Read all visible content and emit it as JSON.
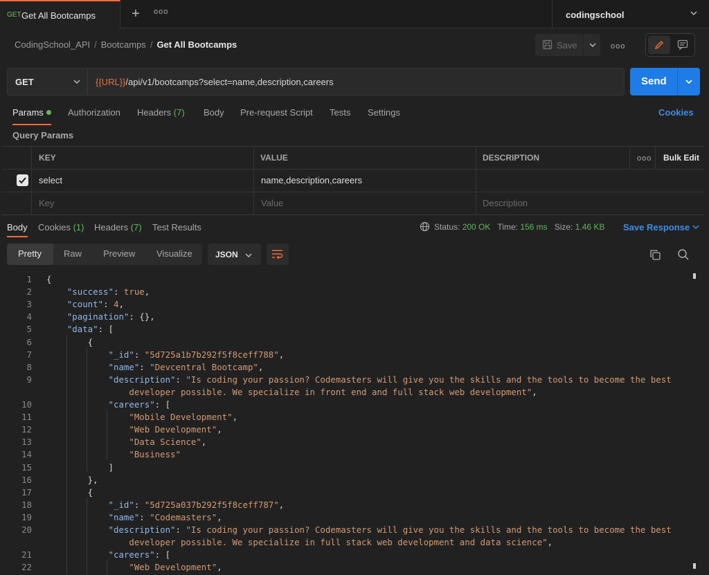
{
  "tab": {
    "method": "GET",
    "name": "Get All Bootcamps",
    "plus": "+",
    "more": "ooo"
  },
  "environment": {
    "name": "codingschool"
  },
  "breadcrumb": {
    "collection": "CodingSchool_API",
    "folder": "Bootcamps",
    "request": "Get All Bootcamps",
    "sep": "/"
  },
  "toolbar": {
    "save_label": "Save",
    "more": "ooo"
  },
  "request": {
    "method": "GET",
    "url_var": "{{URL}}",
    "url_path": "/api/v1/bootcamps?select=name,description,careers",
    "send_label": "Send"
  },
  "request_tabs": {
    "params": "Params",
    "authorization": "Authorization",
    "headers": "Headers",
    "headers_count": "(7)",
    "body": "Body",
    "prerequest": "Pre-request Script",
    "tests": "Tests",
    "settings": "Settings",
    "cookies": "Cookies"
  },
  "query_params": {
    "label": "Query Params",
    "columns": {
      "key": "KEY",
      "value": "VALUE",
      "description": "DESCRIPTION"
    },
    "more": "ooo",
    "bulk_edit": "Bulk Edit",
    "rows": [
      {
        "key": "select",
        "value": "name,description,careers",
        "description": "",
        "checked": true
      }
    ],
    "placeholder": {
      "key": "Key",
      "value": "Value",
      "description": "Description"
    }
  },
  "response_tabs": {
    "body": "Body",
    "cookies": "Cookies",
    "cookies_count": "(1)",
    "headers": "Headers",
    "headers_count": "(7)",
    "test_results": "Test Results"
  },
  "response_status": {
    "status_label": "Status:",
    "status": "200 OK",
    "time_label": "Time:",
    "time": "156 ms",
    "size_label": "Size:",
    "size": "1.46 KB",
    "save_response": "Save Response"
  },
  "format": {
    "pretty": "Pretty",
    "raw": "Raw",
    "preview": "Preview",
    "visualize": "Visualize",
    "language": "JSON"
  },
  "code_lines": [
    {
      "n": "1",
      "html": "{"
    },
    {
      "n": "2",
      "html": "    <span class='k'>\"success\"</span>: <span class='b'>true</span>,"
    },
    {
      "n": "3",
      "html": "    <span class='k'>\"count\"</span>: <span class='b'>4</span>,"
    },
    {
      "n": "4",
      "html": "    <span class='k'>\"pagination\"</span>: {},"
    },
    {
      "n": "5",
      "html": "    <span class='k'>\"data\"</span>: ["
    },
    {
      "n": "6",
      "html": "        {"
    },
    {
      "n": "7",
      "html": "            <span class='k'>\"_id\"</span>: <span class='s'>\"5d725a1b7b292f5f8ceff788\"</span>,"
    },
    {
      "n": "8",
      "html": "            <span class='k'>\"name\"</span>: <span class='s'>\"Devcentral Bootcamp\"</span>,"
    },
    {
      "n": "9",
      "html": "            <span class='k'>\"description\"</span>: <span class='s'>\"Is coding your passion? Codemasters will give you the skills and the tools to become the best</span>"
    },
    {
      "n": "",
      "html": "<span class='s'>                developer possible. We specialize in front end and full stack web development\"</span>,"
    },
    {
      "n": "10",
      "html": "            <span class='k'>\"careers\"</span>: ["
    },
    {
      "n": "11",
      "html": "                <span class='s'>\"Mobile Development\"</span>,"
    },
    {
      "n": "12",
      "html": "                <span class='s'>\"Web Development\"</span>,"
    },
    {
      "n": "13",
      "html": "                <span class='s'>\"Data Science\"</span>,"
    },
    {
      "n": "14",
      "html": "                <span class='s'>\"Business\"</span>"
    },
    {
      "n": "15",
      "html": "            ]"
    },
    {
      "n": "16",
      "html": "        },"
    },
    {
      "n": "17",
      "html": "        {"
    },
    {
      "n": "18",
      "html": "            <span class='k'>\"_id\"</span>: <span class='s'>\"5d725a037b292f5f8ceff787\"</span>,"
    },
    {
      "n": "19",
      "html": "            <span class='k'>\"name\"</span>: <span class='s'>\"Codemasters\"</span>,"
    },
    {
      "n": "20",
      "html": "            <span class='k'>\"description\"</span>: <span class='s'>\"Is coding your passion? Codemasters will give you the skills and the tools to become the best</span>"
    },
    {
      "n": "",
      "html": "<span class='s'>                developer possible. We specialize in full stack web development and data science\"</span>,"
    },
    {
      "n": "21",
      "html": "            <span class='k'>\"careers\"</span>: ["
    },
    {
      "n": "22",
      "html": "                <span class='s'>\"Web Development\"</span>,"
    }
  ]
}
